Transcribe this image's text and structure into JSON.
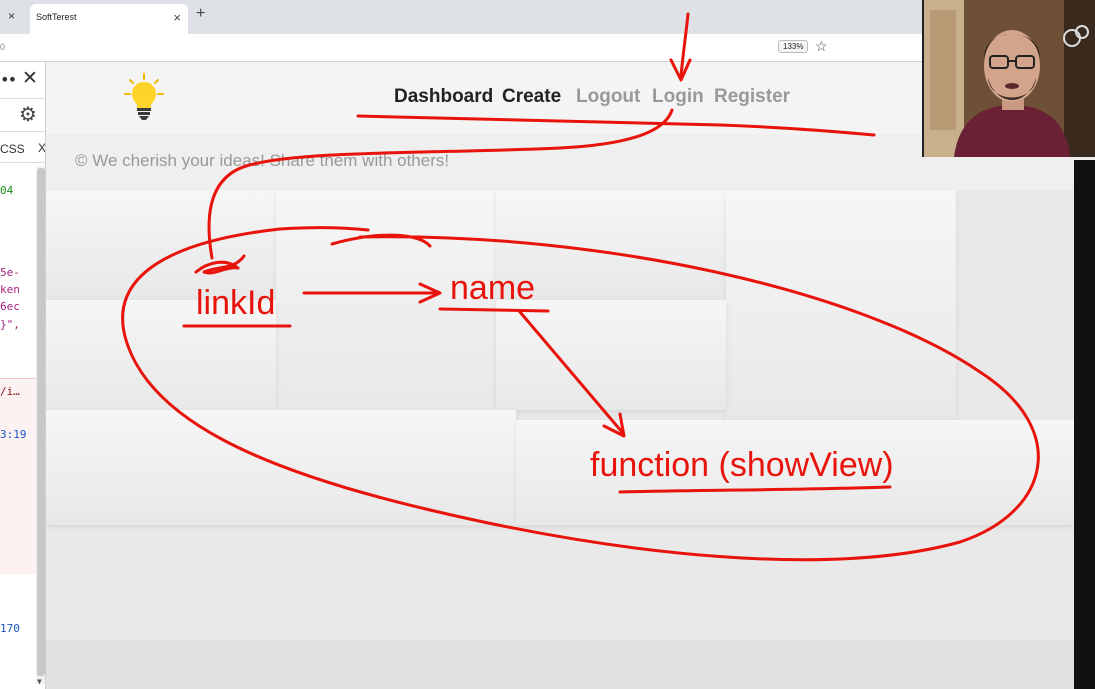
{
  "browser": {
    "tab_close_left": "×",
    "tab_title": "SoftTerest",
    "tab_close": "×",
    "new_tab": "+",
    "address_fragment": "0",
    "zoom": "133%"
  },
  "devtools": {
    "dots": "••",
    "close": "✕",
    "gear": "⚙",
    "css_tab": "CSS",
    "css_close": "X",
    "lines": [
      {
        "text": "04",
        "color": "#1a8a1a"
      },
      {
        "text": "5e-",
        "color": "#a2237f"
      },
      {
        "text": "ken",
        "color": "#a2237f"
      },
      {
        "text": "6ec",
        "color": "#a2237f"
      },
      {
        "text": "}\",",
        "color": "#a2237f"
      },
      {
        "text": "/i…",
        "color": "#8b1a1a"
      },
      {
        "text": "3:19",
        "color": "#1a56c8"
      },
      {
        "text": "170",
        "color": "#1a56c8"
      }
    ]
  },
  "site": {
    "nav": {
      "dashboard": "Dashboard",
      "create": "Create",
      "logout": "Logout",
      "login": "Login",
      "register": "Register"
    },
    "hero_text": "© We cherish your ideas! Share them with others!"
  },
  "annotations": {
    "color": "#e8140c",
    "link_id": "linkId",
    "name": "name",
    "function": "function (showView)"
  },
  "colors": {
    "annotation_red": "#e8140c",
    "nav_active": "#222222",
    "nav_inactive": "#999999"
  }
}
